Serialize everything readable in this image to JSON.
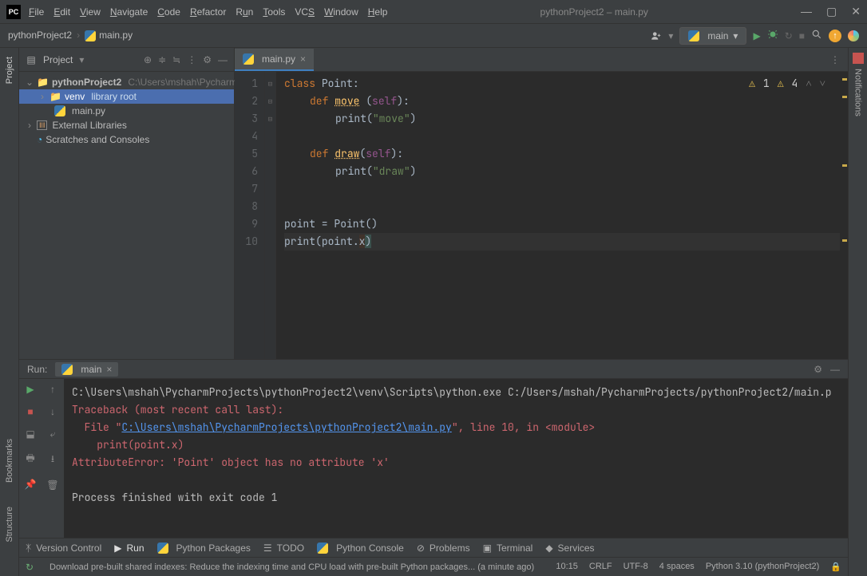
{
  "window": {
    "title": "pythonProject2 – main.py"
  },
  "menus": [
    "File",
    "Edit",
    "View",
    "Navigate",
    "Code",
    "Refactor",
    "Run",
    "Tools",
    "VCS",
    "Window",
    "Help"
  ],
  "breadcrumb": {
    "root": "pythonProject2",
    "file": "main.py"
  },
  "runconfig": {
    "label": "main"
  },
  "project": {
    "title": "Project",
    "root": "pythonProject2",
    "root_path": "C:\\Users\\mshah\\Pycharm",
    "venv": "venv",
    "venv_tag": "library root",
    "file1": "main.py",
    "ext_lib": "External Libraries",
    "scratches": "Scratches and Consoles"
  },
  "editor": {
    "tab": "main.py",
    "lines": [
      "1",
      "2",
      "3",
      "4",
      "5",
      "6",
      "7",
      "8",
      "9",
      "10"
    ],
    "warn1": "1",
    "warn2": "4"
  },
  "code": {
    "l1a": "class",
    "l1b": " Point:",
    "l2a": "def",
    "l2b": "move",
    "l2c": " (",
    "l2d": "self",
    "l2e": "):",
    "l3a": "print(",
    "l3b": "\"move\"",
    "l3c": ")",
    "l5a": "def",
    "l5b": "draw",
    "l5c": "(",
    "l5d": "self",
    "l5e": "):",
    "l6a": "print(",
    "l6b": "\"draw\"",
    "l6c": ")",
    "l9a": "point = Point()",
    "l10a": "print",
    "l10b": "(point.",
    "l10c": "x",
    "l10d": ")"
  },
  "run": {
    "title": "Run:",
    "tab": "main",
    "line1": "C:\\Users\\mshah\\PycharmProjects\\pythonProject2\\venv\\Scripts\\python.exe C:/Users/mshah/PycharmProjects/pythonProject2/main.p",
    "tb": "Traceback (most recent call last):",
    "file_pre": "  File \"",
    "file_link": "C:\\Users\\mshah\\PycharmProjects\\pythonProject2\\main.py",
    "file_post": "\", line 10, in <module>",
    "err_line": "    print(point.x)",
    "attr_err": "AttributeError: 'Point' object has no attribute 'x'",
    "exit": "Process finished with exit code 1"
  },
  "bottom_tools": {
    "vcs": "Version Control",
    "run": "Run",
    "pkgs": "Python Packages",
    "todo": "TODO",
    "console": "Python Console",
    "problems": "Problems",
    "terminal": "Terminal",
    "services": "Services"
  },
  "status": {
    "msg": "Download pre-built shared indexes: Reduce the indexing time and CPU load with pre-built Python packages... (a minute ago)",
    "pos": "10:15",
    "crlf": "CRLF",
    "enc": "UTF-8",
    "indent": "4 spaces",
    "interp": "Python 3.10 (pythonProject2)"
  },
  "sidebars": {
    "project": "Project",
    "bookmarks": "Bookmarks",
    "structure": "Structure",
    "notifications": "Notifications"
  }
}
